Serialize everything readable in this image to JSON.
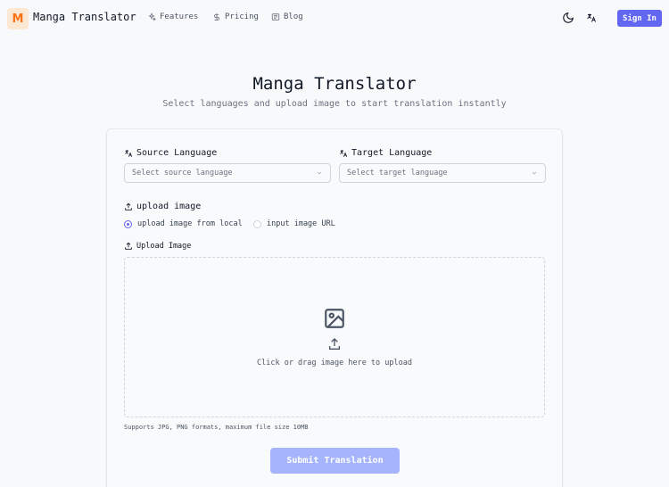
{
  "header": {
    "logo_letter": "M",
    "brand": "Manga Translator",
    "nav": [
      {
        "label": "Features",
        "icon": "sparkles-icon"
      },
      {
        "label": "Pricing",
        "icon": "dollar-icon"
      },
      {
        "label": "Blog",
        "icon": "newspaper-icon"
      }
    ],
    "sign_in": "Sign In"
  },
  "page": {
    "title": "Manga Translator",
    "subtitle": "Select languages and upload image to start translation instantly"
  },
  "form": {
    "source_label": "Source Language",
    "source_placeholder": "Select source language",
    "target_label": "Target Language",
    "target_placeholder": "Select target language",
    "upload_mode_label": "upload image",
    "options": [
      {
        "label": "upload image from local",
        "checked": true
      },
      {
        "label": "input image URL",
        "checked": false
      }
    ],
    "upload_label": "Upload Image",
    "dropzone_text": "Click or drag image here to upload",
    "hint": "Supports JPG, PNG formats, maximum file size 10MB",
    "submit": "Submit Translation"
  },
  "colors": {
    "accent": "#6366f1",
    "submit_disabled": "#a5b4fc",
    "logo_bg": "#fde8d4",
    "logo_fg": "#f97316"
  }
}
